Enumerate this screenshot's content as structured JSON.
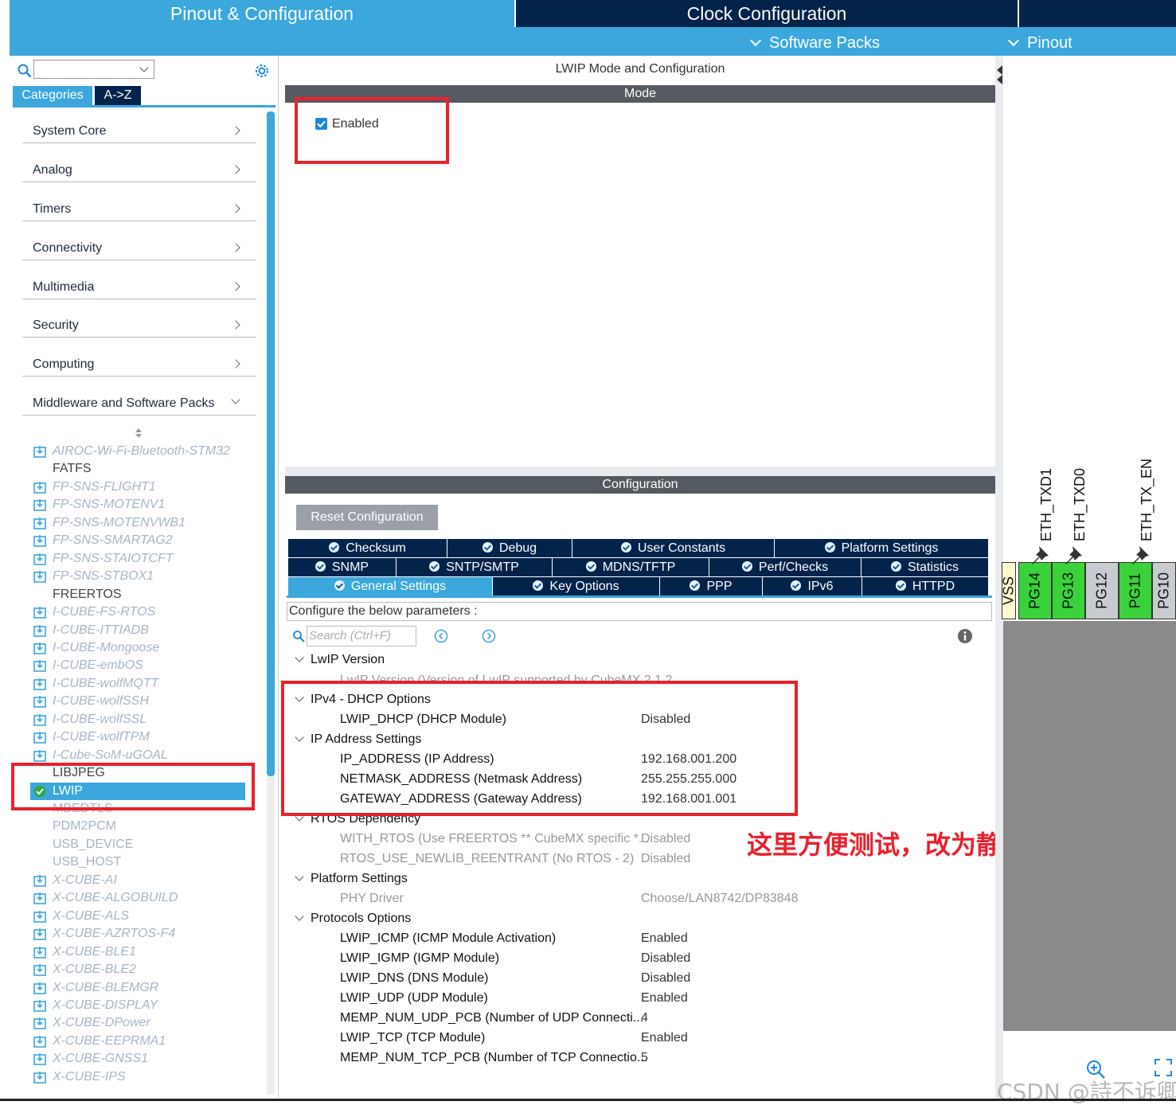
{
  "header": {
    "tab_pinout": "Pinout & Configuration",
    "tab_clock": "Clock Configuration",
    "software_packs": "Software Packs",
    "pinout": "Pinout"
  },
  "left": {
    "tab_categories": "Categories",
    "tab_az": "A->Z",
    "categories": [
      {
        "label": "System Core"
      },
      {
        "label": "Analog"
      },
      {
        "label": "Timers"
      },
      {
        "label": "Connectivity"
      },
      {
        "label": "Multimedia"
      },
      {
        "label": "Security"
      },
      {
        "label": "Computing"
      },
      {
        "label": "Middleware and Software Packs"
      }
    ],
    "middleware": [
      "AIROC-Wi-Fi-Bluetooth-STM32",
      "FATFS",
      "FP-SNS-FLIGHT1",
      "FP-SNS-MOTENV1",
      "FP-SNS-MOTENVWB1",
      "FP-SNS-SMARTAG2",
      "FP-SNS-STAIOTCFT",
      "FP-SNS-STBOX1",
      "FREERTOS",
      "I-CUBE-FS-RTOS",
      "I-CUBE-ITTIADB",
      "I-CUBE-Mongoose",
      "I-CUBE-embOS",
      "I-CUBE-wolfMQTT",
      "I-CUBE-wolfSSH",
      "I-CUBE-wolfSSL",
      "I-CUBE-wolfTPM",
      "I-Cube-SoM-uGOAL",
      "LIBJPEG",
      "LWIP",
      "MBEDTLS",
      "PDM2PCM",
      "USB_DEVICE",
      "USB_HOST",
      "X-CUBE-AI",
      "X-CUBE-ALGOBUILD",
      "X-CUBE-ALS",
      "X-CUBE-AZRTOS-F4",
      "X-CUBE-BLE1",
      "X-CUBE-BLE2",
      "X-CUBE-BLEMGR",
      "X-CUBE-DISPLAY",
      "X-CUBE-DPower",
      "X-CUBE-EEPRMA1",
      "X-CUBE-GNSS1",
      "X-CUBE-IPS"
    ]
  },
  "mid": {
    "title": "LWIP Mode and Configuration",
    "mode_bar": "Mode",
    "enabled_label": "Enabled",
    "config_bar": "Configuration",
    "reset_button": "Reset Configuration",
    "tabs_row1": [
      "Checksum",
      "Debug",
      "User Constants",
      "Platform Settings"
    ],
    "tabs_row2": [
      "SNMP",
      "SNTP/SMTP",
      "MDNS/TFTP",
      "Perf/Checks",
      "Statistics"
    ],
    "tabs_row3": [
      "General Settings",
      "Key Options",
      "PPP",
      "IPv6",
      "HTTPD"
    ],
    "config_hint": "Configure the below parameters :",
    "search_placeholder": "Search (Ctrl+F)",
    "groups": {
      "lwip_version": "LwIP Version",
      "lwip_version_param": "LwIP Version (Version of LwIP supported by CubeMX 2.1.2",
      "ipv4_dhcp": "IPv4 - DHCP Options",
      "ip_address_settings": "IP Address Settings",
      "rtos_dependency": "RTOS Dependency",
      "platform_settings": "Platform Settings",
      "protocols_options": "Protocols Options"
    },
    "params": {
      "lwip_dhcp": {
        "name": "LWIP_DHCP (DHCP Module)",
        "value": "Disabled"
      },
      "ip_address": {
        "name": "IP_ADDRESS (IP Address)",
        "value": "192.168.001.200"
      },
      "netmask": {
        "name": "NETMASK_ADDRESS (Netmask Address)",
        "value": "255.255.255.000"
      },
      "gateway": {
        "name": "GATEWAY_ADDRESS (Gateway Address)",
        "value": "192.168.001.001"
      },
      "with_rtos": {
        "name": "WITH_RTOS (Use FREERTOS ** CubeMX specific *...",
        "value": "Disabled"
      },
      "rtos_newlib": {
        "name": "RTOS_USE_NEWLIB_REENTRANT (No RTOS - 2)",
        "value": "Disabled"
      },
      "phy_driver": {
        "name": "PHY Driver",
        "value": "Choose/LAN8742/DP83848"
      },
      "lwip_icmp": {
        "name": "LWIP_ICMP (ICMP Module Activation)",
        "value": "Enabled"
      },
      "lwip_igmp": {
        "name": "LWIP_IGMP (IGMP Module)",
        "value": "Disabled"
      },
      "lwip_dns": {
        "name": "LWIP_DNS (DNS Module)",
        "value": "Disabled"
      },
      "lwip_udp": {
        "name": "LWIP_UDP (UDP Module)",
        "value": "Enabled"
      },
      "memp_udp": {
        "name": "MEMP_NUM_UDP_PCB (Number of UDP Connecti...",
        "value": "4"
      },
      "lwip_tcp": {
        "name": "LWIP_TCP (TCP Module)",
        "value": "Enabled"
      },
      "memp_tcp": {
        "name": "MEMP_NUM_TCP_PCB (Number of TCP Connectio...",
        "value": "5"
      }
    },
    "annotation": "这里方便测试，改为静态"
  },
  "right": {
    "signals": [
      "ETH_TXD1",
      "ETH_TXD0",
      "ETH_TX_EN"
    ],
    "pins": [
      "VSS",
      "PG14",
      "PG13",
      "PG12",
      "PG11",
      "PG10"
    ],
    "watermark": "CSDN @詩不诉卿"
  },
  "colors": {
    "accent_blue": "#3ba7dd",
    "dark_navy": "#03234b",
    "highlight_red": "#e8212d",
    "pin_green": "#3ad23a"
  }
}
